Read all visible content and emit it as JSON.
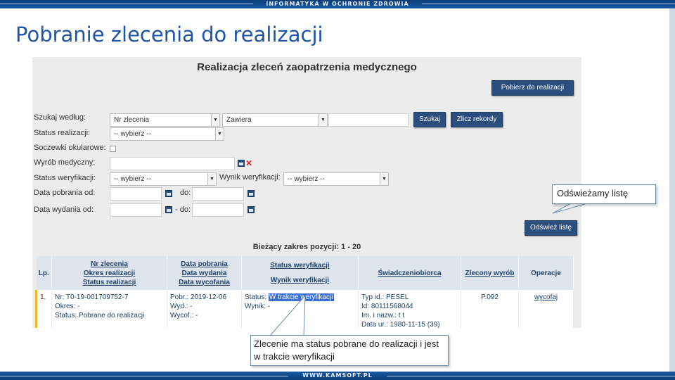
{
  "slide": {
    "tagline": "INFORMATYKA W OCHRONIE ZDROWIA",
    "footer": "WWW.KAMSOFT.PL",
    "title": "Pobranie zlecenia do realizacji"
  },
  "form": {
    "title": "Realizacja zleceń zaopatrzenia medycznego",
    "pobierz_button": "Pobierz do realizacji",
    "szukaj_label": "Szukaj według:",
    "szukaj_field": "Nr zlecenia",
    "szukaj_mode": "Zawiera",
    "szukaj_button": "Szukaj",
    "zlicz_button": "Zlicz rekordy",
    "status_realizacji_label": "Status realizacji:",
    "status_realizacji_value": "-- wybierz --",
    "soczewki_label": "Soczewki okularowe:",
    "wyrob_label": "Wyrób medyczny:",
    "status_weryfikacji_label": "Status weryfikacji:",
    "status_weryfikacji_value": "-- wybierz --",
    "wynik_weryfikacji_label": "Wynik weryfikacji:",
    "wynik_weryfikacji_value": "-- wybierz --",
    "data_pobrania_label": "Data pobrania od:",
    "data_wydania_label": "Data wydania od:",
    "do_label": "do:",
    "do_label2": "- do:",
    "odswiez_button": "Odśwież listę",
    "range": "Bieżący zakres pozycji: 1 - 20"
  },
  "table": {
    "headers": {
      "lp": "Lp.",
      "nr": [
        "Nr zlecenia",
        "Okres realizacji",
        "Status realizacji"
      ],
      "data": [
        "Data pobrania",
        "Data wydania",
        "Data wycofania"
      ],
      "status": [
        "Status weryfikacji",
        "Wynik weryfikacji"
      ],
      "swiad": "Świadczeniobiorca",
      "wyrob": "Zlecony wyrób",
      "oper": "Operacje"
    },
    "row": {
      "lp": "1.",
      "nr": "Nr: T0-19-001709752-7",
      "okres": "Okres: -",
      "status": "Status: Pobrane do realizacji",
      "pobr": "Pobr.: 2019-12-06",
      "wyd": "Wyd.: -",
      "wycof": "Wycof.: -",
      "status_wer_prefix": "Status:",
      "status_wer_value": "W trakcie weryfikacji",
      "wynik": "Wynik: -",
      "typ_id": "Typ id.: PESEL",
      "id": "Id: 80111568044",
      "im_nazw": "Im. i nazw.: t t",
      "data_ur": "Data ur.: 1980-11-15 (39)",
      "wyrob": "P.092",
      "operacja": "wycofaj"
    }
  },
  "callouts": {
    "refresh": "Odświeżamy listę",
    "status_note": "Zlecenie ma status pobrane do realizacji i jest w trakcie weryfikacji"
  },
  "colors": {
    "title_blue": "#1e55a8",
    "button_navy": "#2a4f7e",
    "highlight": "#3b6fd1",
    "row_marker": "#f0b91b"
  }
}
